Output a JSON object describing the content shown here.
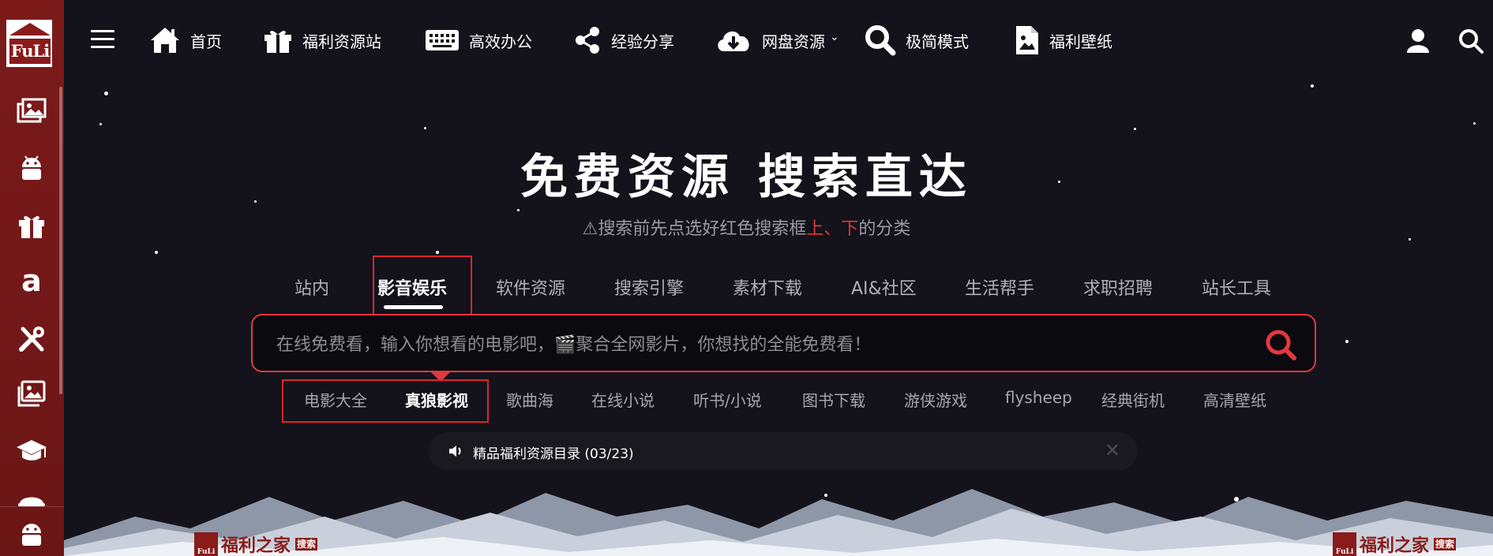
{
  "sidebar": {
    "logo_text": "FuLi",
    "icons": [
      "images-icon",
      "android-icon",
      "gift-icon",
      "amazon-icon",
      "tools-icon",
      "gallery-icon",
      "graduation-cap-icon",
      "hat-icon",
      "android-icon"
    ]
  },
  "nav": {
    "items": [
      {
        "label": "首页",
        "icon": "home-icon"
      },
      {
        "label": "福利资源站",
        "icon": "gift-icon"
      },
      {
        "label": "高效办公",
        "icon": "keyboard-icon"
      },
      {
        "label": "经验分享",
        "icon": "share-icon"
      },
      {
        "label": "网盘资源",
        "icon": "cloud-download-icon"
      },
      {
        "label": "极简模式",
        "icon": "search-icon"
      },
      {
        "label": "福利壁纸",
        "icon": "image-file-icon"
      }
    ]
  },
  "hero": {
    "title": "免费资源 搜索直达",
    "sub_prefix": "⚠搜索前先点选好红色搜索框",
    "sub_up": "上",
    "sub_sep": "、",
    "sub_down": "下",
    "sub_suffix": "的分类"
  },
  "categories": [
    "站内",
    "影音娱乐",
    "软件资源",
    "搜索引擎",
    "素材下载",
    "AI&社区",
    "生活帮手",
    "求职招聘",
    "站长工具"
  ],
  "active_category": "影音娱乐",
  "search": {
    "placeholder": "在线免费看，输入你想看的电影吧，🎬聚合全网影片，你想找的全能免费看！"
  },
  "subcategories": [
    "电影大全",
    "真狼影视",
    "歌曲海",
    "在线小说",
    "听书/小说",
    "图书下载",
    "游侠游戏",
    "flysheep",
    "经典街机",
    "高清壁纸"
  ],
  "active_subcategory": "真狼影视",
  "notice": {
    "text": "精品福利资源目录 (03/23)"
  },
  "bottom": {
    "logo_text": "福利之家",
    "logo_small": "FuLi",
    "tag": "搜索"
  },
  "colors": {
    "sidebar": "#7c1a1a",
    "background": "#14121b",
    "accent_red": "#e1393f"
  }
}
